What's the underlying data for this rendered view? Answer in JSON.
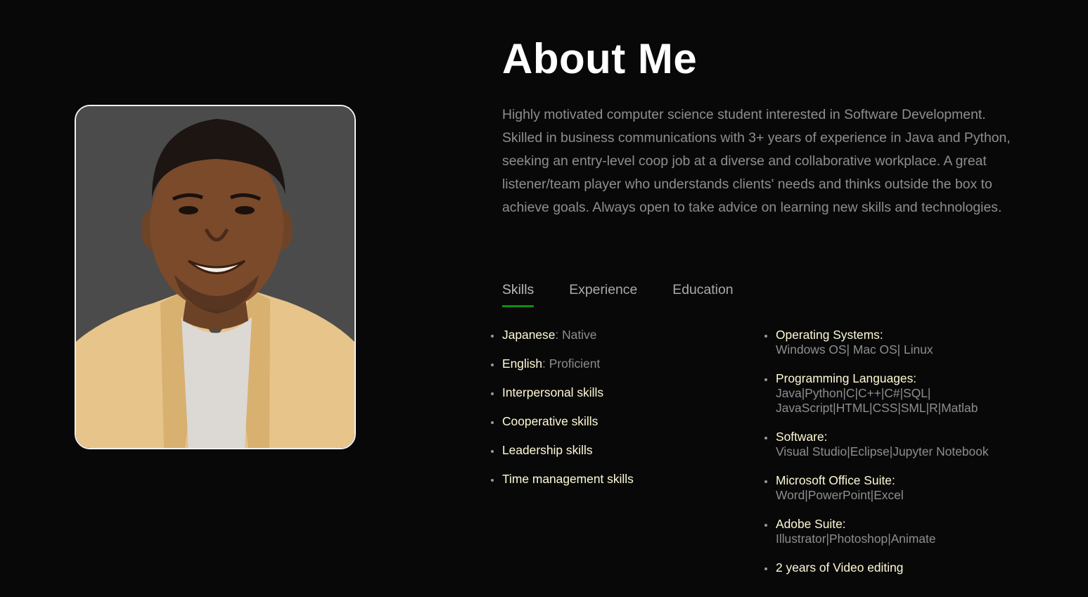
{
  "about": {
    "title": "About Me",
    "bio": "Highly motivated computer science student interested in Software Development. Skilled in business communications with 3+ years of experience in Java and Python, seeking an entry-level coop job at a diverse and collaborative workplace. A great listener/team player who understands clients' needs and thinks outside the box to achieve goals. Always open to take advice on learning new skills and technologies."
  },
  "tabs": [
    {
      "label": "Skills",
      "active": true
    },
    {
      "label": "Experience",
      "active": false
    },
    {
      "label": "Education",
      "active": false
    }
  ],
  "skills_left": [
    {
      "label": "Japanese",
      "sep": ":",
      "value": " Native"
    },
    {
      "label": "English",
      "sep": ":",
      "value": " Proficient"
    },
    {
      "label": "Interpersonal skills"
    },
    {
      "label": "Cooperative skills"
    },
    {
      "label": "Leadership skills"
    },
    {
      "label": "Time management skills"
    }
  ],
  "skills_right": [
    {
      "label": "Operating Systems:",
      "lines": [
        "Windows OS| Mac OS| Linux"
      ]
    },
    {
      "label": "Programming Languages:",
      "lines": [
        "Java|Python|C|C++|C#|SQL|",
        "JavaScript|HTML|CSS|SML|R|Matlab"
      ]
    },
    {
      "label": "Software:",
      "lines": [
        "Visual Studio|Eclipse|Jupyter Notebook"
      ]
    },
    {
      "label": "Microsoft Office Suite:",
      "lines": [
        "Word|PowerPoint|Excel"
      ]
    },
    {
      "label": "Adobe Suite:",
      "lines": [
        "Illustrator|Photoshop|Animate"
      ]
    },
    {
      "label": "2 years of Video editing"
    }
  ],
  "colors": {
    "background": "#080808",
    "accent": "#118c11",
    "label": "#fffad6",
    "muted": "#8e8e8e"
  }
}
